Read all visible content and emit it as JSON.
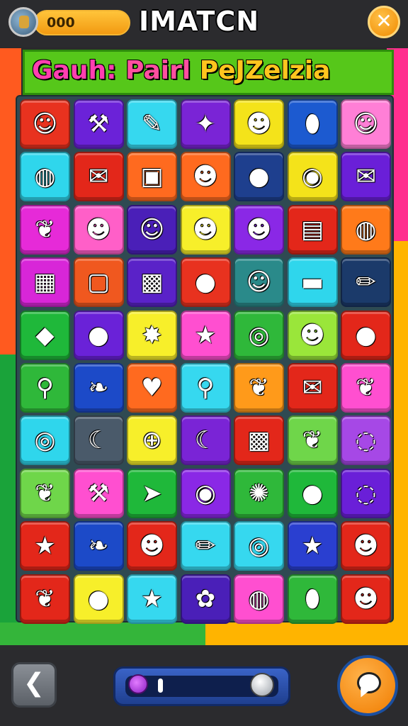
{
  "header": {
    "coin_value": "000",
    "title": "IMATCN",
    "close_glyph": "✕"
  },
  "banner": {
    "word1": "Gauh:",
    "word2": "Pairl",
    "word3": "PeJZelzia"
  },
  "board": {
    "columns": 7,
    "rows": 10,
    "tiles": [
      {
        "color": "#e8321f",
        "icon": "face-icon",
        "glyph": "☺"
      },
      {
        "color": "#6b22d8",
        "icon": "wand-icon",
        "glyph": "⚒"
      },
      {
        "color": "#36d8ef",
        "icon": "marker-icon",
        "glyph": "✎"
      },
      {
        "color": "#7a24d6",
        "icon": "star-wand-icon",
        "glyph": "✦"
      },
      {
        "color": "#f4e31a",
        "icon": "face-icon",
        "glyph": "☻"
      },
      {
        "color": "#1c5ad0",
        "icon": "capsule-icon",
        "glyph": "⬮"
      },
      {
        "color": "#ff7fd6",
        "icon": "ghost-icon",
        "glyph": "☺"
      },
      {
        "color": "#2fd6ec",
        "icon": "swirl-icon",
        "glyph": "◍"
      },
      {
        "color": "#e3271a",
        "icon": "envelope-icon",
        "glyph": "✉"
      },
      {
        "color": "#ff6a1f",
        "icon": "cube-icon",
        "glyph": "▣"
      },
      {
        "color": "#ff6a1f",
        "icon": "pumpkin-face-icon",
        "glyph": "☻"
      },
      {
        "color": "#1e3f8e",
        "icon": "apple-icon",
        "glyph": "●"
      },
      {
        "color": "#f4e31a",
        "icon": "swirl-icon",
        "glyph": "◉"
      },
      {
        "color": "#6a1fd8",
        "icon": "package-icon",
        "glyph": "✉"
      },
      {
        "color": "#e62ad8",
        "icon": "leaf-icon",
        "glyph": "❦"
      },
      {
        "color": "#ff5fc8",
        "icon": "pumpkin-icon",
        "glyph": "☻"
      },
      {
        "color": "#4a1fb8",
        "icon": "face-icon",
        "glyph": "☺"
      },
      {
        "color": "#f7ef2a",
        "icon": "face-icon",
        "glyph": "☻"
      },
      {
        "color": "#8a28e6",
        "icon": "face-icon",
        "glyph": "☻"
      },
      {
        "color": "#e3271a",
        "icon": "book-icon",
        "glyph": "▤"
      },
      {
        "color": "#ff7a1a",
        "icon": "ball-icon",
        "glyph": "◍"
      },
      {
        "color": "#d826d8",
        "icon": "box-icon",
        "glyph": "▦"
      },
      {
        "color": "#f0581f",
        "icon": "card-face-icon",
        "glyph": "▢"
      },
      {
        "color": "#5a22c8",
        "icon": "robot-icon",
        "glyph": "▩"
      },
      {
        "color": "#e8321f",
        "icon": "tomato-icon",
        "glyph": "●"
      },
      {
        "color": "#2a8a8a",
        "icon": "face-icon",
        "glyph": "☺"
      },
      {
        "color": "#2fd6ec",
        "icon": "cake-icon",
        "glyph": "▬"
      },
      {
        "color": "#1b3a6a",
        "icon": "crayon-icon",
        "glyph": "✏"
      },
      {
        "color": "#1fb83a",
        "icon": "box-icon",
        "glyph": "◆"
      },
      {
        "color": "#6a22d8",
        "icon": "lemon-icon",
        "glyph": "●"
      },
      {
        "color": "#f7ef2a",
        "icon": "blob-icon",
        "glyph": "✸"
      },
      {
        "color": "#ff4fd0",
        "icon": "star-icon",
        "glyph": "★"
      },
      {
        "color": "#2fb83a",
        "icon": "ring-icon",
        "glyph": "◎"
      },
      {
        "color": "#9ae63a",
        "icon": "jelly-face-icon",
        "glyph": "☻"
      },
      {
        "color": "#e3271a",
        "icon": "orange-icon",
        "glyph": "●"
      },
      {
        "color": "#2fb83a",
        "icon": "popsicle-icon",
        "glyph": "⚲"
      },
      {
        "color": "#1c4ac8",
        "icon": "leaf-icon",
        "glyph": "❧"
      },
      {
        "color": "#ff6a1f",
        "icon": "heart-icon",
        "glyph": "♥"
      },
      {
        "color": "#36d8ef",
        "icon": "popsicle-icon",
        "glyph": "⚲"
      },
      {
        "color": "#ff9a1a",
        "icon": "leaf-icon",
        "glyph": "❦"
      },
      {
        "color": "#e3271a",
        "icon": "envelope-icon",
        "glyph": "✉"
      },
      {
        "color": "#ff4fd0",
        "icon": "leaf-icon",
        "glyph": "❦"
      },
      {
        "color": "#2fd6ec",
        "icon": "ring-icon",
        "glyph": "◎"
      },
      {
        "color": "#4a5a6a",
        "icon": "crescent-icon",
        "glyph": "☾"
      },
      {
        "color": "#f7ef2a",
        "icon": "wheel-icon",
        "glyph": "⊕"
      },
      {
        "color": "#7a24d6",
        "icon": "crescent-icon",
        "glyph": "☾"
      },
      {
        "color": "#e3271a",
        "icon": "robot-face-icon",
        "glyph": "▩"
      },
      {
        "color": "#6fd64a",
        "icon": "carrot-icon",
        "glyph": "❦"
      },
      {
        "color": "#a648e6",
        "icon": "bubble-icon",
        "glyph": "◌"
      },
      {
        "color": "#6fd64a",
        "icon": "carrot-icon",
        "glyph": "❦"
      },
      {
        "color": "#ff4fd0",
        "icon": "wand-icon",
        "glyph": "⚒"
      },
      {
        "color": "#1fb83a",
        "icon": "arrow-icon",
        "glyph": "➤"
      },
      {
        "color": "#8a28e6",
        "icon": "lollipop-icon",
        "glyph": "◉"
      },
      {
        "color": "#2fb83a",
        "icon": "gear-icon",
        "glyph": "✺"
      },
      {
        "color": "#1fb83a",
        "icon": "pepper-icon",
        "glyph": "●"
      },
      {
        "color": "#6a1fd8",
        "icon": "speech-icon",
        "glyph": "◌"
      },
      {
        "color": "#e3271a",
        "icon": "star-icon",
        "glyph": "★"
      },
      {
        "color": "#1c4ac8",
        "icon": "leaf-icon",
        "glyph": "❧"
      },
      {
        "color": "#e3271a",
        "icon": "angry-face-icon",
        "glyph": "☻"
      },
      {
        "color": "#36d8ef",
        "icon": "crayon-icon",
        "glyph": "✏"
      },
      {
        "color": "#36d8ef",
        "icon": "spiral-icon",
        "glyph": "◎"
      },
      {
        "color": "#2a3fd0",
        "icon": "star-icon",
        "glyph": "★"
      },
      {
        "color": "#e3271a",
        "icon": "lemon-face-icon",
        "glyph": "☻"
      },
      {
        "color": "#e3271a",
        "icon": "leaf-icon",
        "glyph": "❦"
      },
      {
        "color": "#f7ef2a",
        "icon": "strawberry-icon",
        "glyph": "●"
      },
      {
        "color": "#36d8ef",
        "icon": "star-icon",
        "glyph": "★"
      },
      {
        "color": "#4a1fb8",
        "icon": "flower-icon",
        "glyph": "✿"
      },
      {
        "color": "#ff4fd0",
        "icon": "pepper-icon",
        "glyph": "◍"
      },
      {
        "color": "#2fb83a",
        "icon": "leaf-icon",
        "glyph": "⬮"
      },
      {
        "color": "#e3271a",
        "icon": "pumpkin-face-icon",
        "glyph": "☻"
      }
    ]
  },
  "footer": {
    "back_glyph": "❮",
    "slider_level": 0.15
  }
}
